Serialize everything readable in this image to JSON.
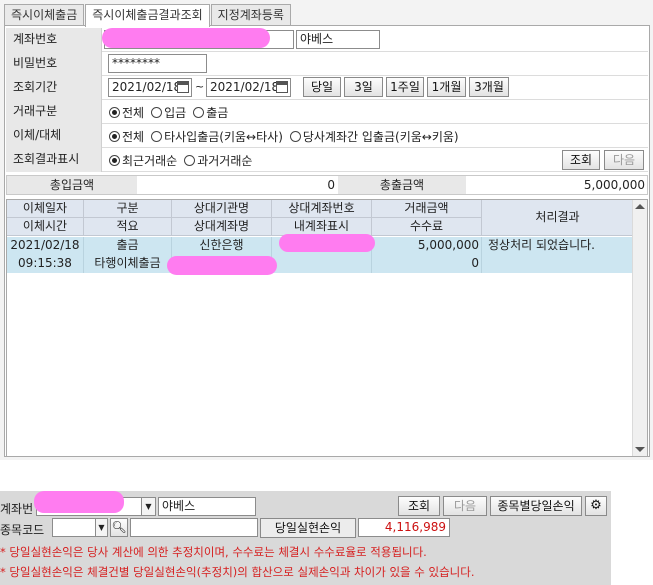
{
  "tabs": [
    "즉시이체출금",
    "즉시이체출금결과조회",
    "지정계좌등록"
  ],
  "form": {
    "account_label": "계좌번호",
    "account_name": "야베스",
    "password_label": "비밀번호",
    "password_value": "********",
    "period_label": "조회기간",
    "date_from": "2021/02/18",
    "date_sep": "~",
    "date_to": "2021/02/18",
    "period_buttons": [
      "당일",
      "3일",
      "1주일",
      "1개월",
      "3개월"
    ],
    "trade_type_label": "거래구분",
    "trade_type_options": [
      "전체",
      "입금",
      "출금"
    ],
    "transfer_label": "이체/대체",
    "transfer_options": [
      "전체",
      "타사입출금(키움↔타사)",
      "당사계좌간 입출금(키움↔키움)"
    ],
    "display_label": "조회결과표시",
    "display_options": [
      "최근거래순",
      "과거거래순"
    ],
    "search_button": "조회",
    "next_button": "다음"
  },
  "totals": {
    "in_label": "총입금액",
    "in_value": "0",
    "out_label": "총출금액",
    "out_value": "5,000,000"
  },
  "grid": {
    "headers_row1": [
      "이체일자",
      "구분",
      "상대기관명",
      "상대계좌번호",
      "거래금액"
    ],
    "headers_row2": [
      "이체시간",
      "적요",
      "상대계좌명",
      "내계좌표시",
      "수수료"
    ],
    "header_result": "처리결과",
    "rows": [
      {
        "date": "2021/02/18",
        "time": "09:15:38",
        "type": "출금",
        "memo": "타행이체출금",
        "bank": "신한은행",
        "amount": "5,000,000",
        "fee": "0",
        "result": "정상처리 되었습니다."
      }
    ]
  },
  "bottom": {
    "account_label": "계좌번",
    "account_name": "야베스",
    "search_button": "조회",
    "next_button": "다음",
    "stock_button": "종목별당일손익",
    "code_label": "종목코드",
    "realized_label": "당일실현손익",
    "realized_value": "4,116,989",
    "notice1": "* 당일실현손익은 당사 계산에 의한 추정치이며, 수수료는 체결시 수수료율로 적용됩니다.",
    "notice2": "* 당일실현손익은 체결건별 당일실현손익(추정치)의 합산으로 실제손익과 차이가 있을 수 있습니다."
  },
  "colors": {
    "selected_row": "#cde6f1",
    "header_bg": "#dfe6f0",
    "redaction": "#ff7cf0",
    "notice_red": "#d61f1f",
    "value_red": "#cc1111"
  }
}
